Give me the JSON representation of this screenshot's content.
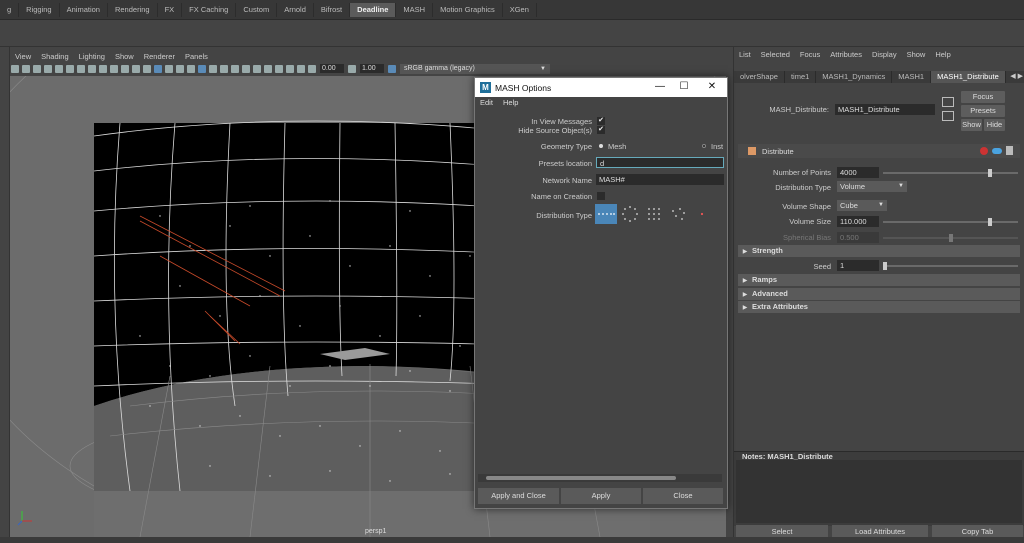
{
  "shelf_tabs": [
    "g",
    "Rigging",
    "Animation",
    "Rendering",
    "FX",
    "FX Caching",
    "Custom",
    "Arnold",
    "Bifrost",
    "Deadline",
    "MASH",
    "Motion Graphics",
    "XGen"
  ],
  "shelf_active": "Deadline",
  "viewport_menu": [
    "View",
    "Shading",
    "Lighting",
    "Show",
    "Renderer",
    "Panels"
  ],
  "viewport_toolbar": {
    "exposure": "0.00",
    "gamma": "1.00",
    "color_space": "sRGB gamma (legacy)"
  },
  "viewport_label": "persp1",
  "attr_editor": {
    "menu": [
      "List",
      "Selected",
      "Focus",
      "Attributes",
      "Display",
      "Show",
      "Help"
    ],
    "tabs": [
      "olverShape",
      "time1",
      "MASH1_Dynamics",
      "MASH1",
      "MASH1_Distribute"
    ],
    "active_tab": "MASH1_Distribute",
    "node_label": "MASH_Distribute:",
    "node_value": "MASH1_Distribute",
    "focus_btn": "Focus",
    "presets_btn": "Presets",
    "show_btn": "Show",
    "hide_btn": "Hide",
    "section_title": "Distribute",
    "num_points_label": "Number of Points",
    "num_points_value": "4000",
    "num_points_fraction": 0.8,
    "dist_type_label": "Distribution Type",
    "dist_type_value": "Volume",
    "vol_shape_label": "Volume Shape",
    "vol_shape_value": "Cube",
    "vol_size_label": "Volume Size",
    "vol_size_value": "110.000",
    "vol_size_fraction": 0.8,
    "sph_bias_label": "Spherical Bias",
    "sph_bias_value": "0.500",
    "sph_bias_fraction": 0.5,
    "strength_section": "Strength",
    "seed_label": "Seed",
    "seed_value": "1",
    "collapsed_sections": [
      "Ramps",
      "Advanced",
      "Extra Attributes"
    ],
    "notes_title": "Notes:  MASH1_Distribute",
    "bottom_buttons": [
      "Select",
      "Load Attributes",
      "Copy Tab"
    ]
  },
  "mash_dialog": {
    "title": "MASH Options",
    "logo": "M",
    "menu": [
      "Edit",
      "Help"
    ],
    "in_view_label": "In View Messages",
    "hide_source_label": "Hide Source Object(s)",
    "check_mark": "✔",
    "geom_type_label": "Geometry Type",
    "geom_opt1": "Mesh",
    "geom_opt2": "Inst",
    "presets_loc_label": "Presets location",
    "presets_loc_value": "d",
    "network_name_label": "Network Name",
    "network_name_value": "MASH#",
    "name_on_creation_label": "Name on Creation",
    "dist_type_label": "Distribution Type",
    "buttons": [
      "Apply and Close",
      "Apply",
      "Close"
    ]
  }
}
